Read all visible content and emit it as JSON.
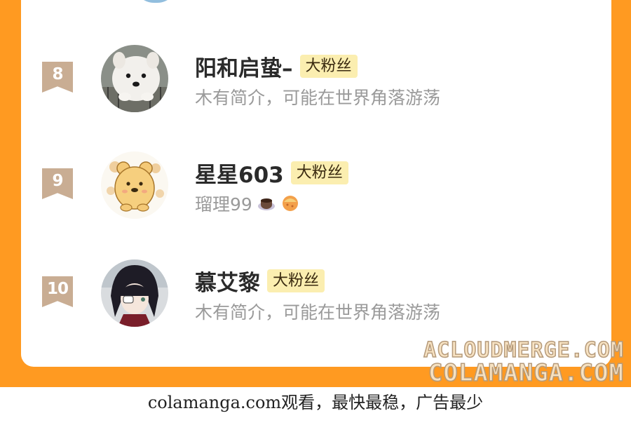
{
  "ranking": [
    {
      "rank": "8",
      "name": "阳和启蛰–",
      "badge": "大粉丝",
      "bio": "木有简介，可能在世界角落游荡",
      "avatar_icon": "samoyed-dog-avatar"
    },
    {
      "rank": "9",
      "name": "星星603",
      "badge": "大粉丝",
      "bio": "瑠理99",
      "bio_icons": [
        "coffee-cup-icon",
        "pastry-icon"
      ],
      "avatar_icon": "cartoon-bear-avatar"
    },
    {
      "rank": "10",
      "name": "慕艾黎",
      "badge": "大粉丝",
      "bio": "木有简介，可能在世界角落游荡",
      "avatar_icon": "anime-girl-avatar"
    }
  ],
  "watermark": {
    "line1": "ACLOUDMERGE.COM",
    "line2": "COLAMANGA.COM"
  },
  "footer_text": "colamanga.com观看，最快最稳，广告最少",
  "colors": {
    "frame": "#ff9a21",
    "badge_bg": "#fbeeb0",
    "rank_bg": "#c9ad93"
  }
}
